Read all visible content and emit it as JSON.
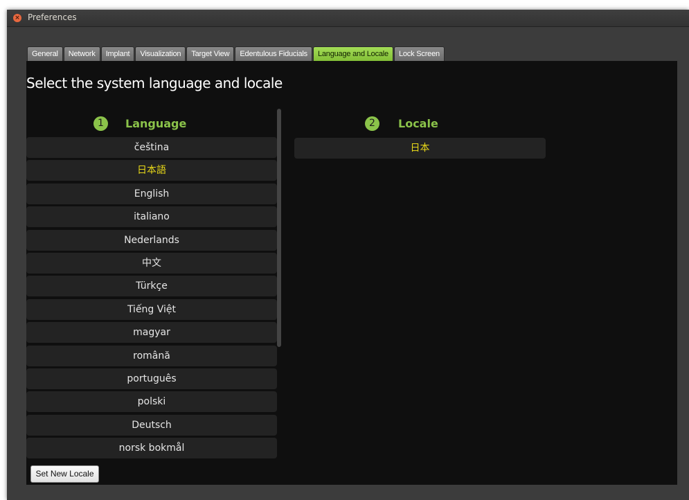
{
  "window": {
    "title": "Preferences",
    "close_icon": "×"
  },
  "tabs": [
    {
      "label": "General",
      "active": false
    },
    {
      "label": "Network",
      "active": false
    },
    {
      "label": "Implant",
      "active": false
    },
    {
      "label": "Visualization",
      "active": false
    },
    {
      "label": "Target View",
      "active": false
    },
    {
      "label": "Edentulous Fiducials",
      "active": false
    },
    {
      "label": "Language and Locale",
      "active": true
    },
    {
      "label": "Lock Screen",
      "active": false
    }
  ],
  "page": {
    "title": "Select the system language and locale"
  },
  "language": {
    "step": "1",
    "label": "Language",
    "items": [
      {
        "label": "čeština",
        "selected": false
      },
      {
        "label": "日本語",
        "selected": true
      },
      {
        "label": "English",
        "selected": false
      },
      {
        "label": "italiano",
        "selected": false
      },
      {
        "label": "Nederlands",
        "selected": false
      },
      {
        "label": "中文",
        "selected": false
      },
      {
        "label": "Türkçe",
        "selected": false
      },
      {
        "label": "Tiếng Việt",
        "selected": false
      },
      {
        "label": "magyar",
        "selected": false
      },
      {
        "label": "română",
        "selected": false
      },
      {
        "label": "português",
        "selected": false
      },
      {
        "label": "polski",
        "selected": false
      },
      {
        "label": "Deutsch",
        "selected": false
      },
      {
        "label": "norsk bokmål",
        "selected": false
      }
    ]
  },
  "locale": {
    "step": "2",
    "label": "Locale",
    "items": [
      {
        "label": "日本",
        "selected": true
      }
    ]
  },
  "buttons": {
    "set_new_locale": "Set New Locale"
  },
  "colors": {
    "accent": "#8bc34a",
    "active_tab": "#9ad14e",
    "selected_text": "#e8d818",
    "background": "#0f0f0f"
  }
}
